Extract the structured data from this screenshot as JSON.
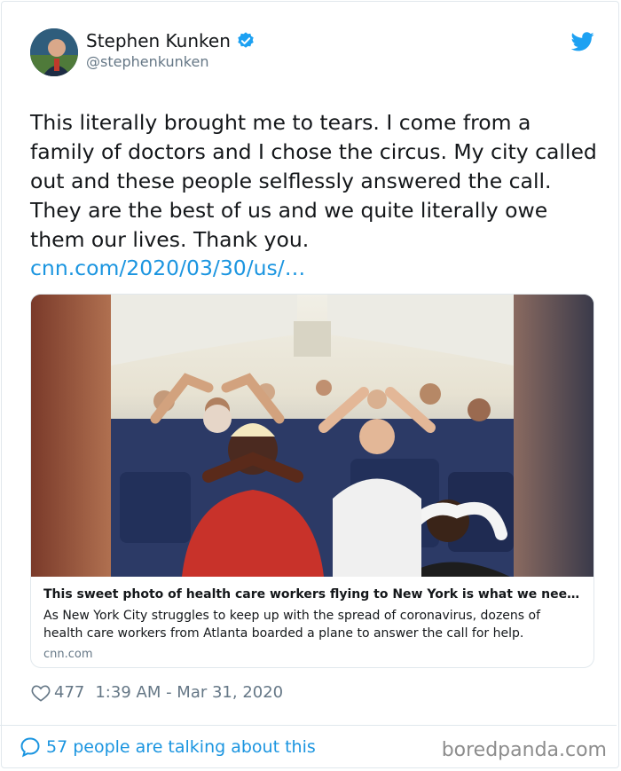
{
  "author": {
    "name": "Stephen Kunken",
    "handle": "@stephenkunken",
    "verified_icon": "verified-badge-icon",
    "avatar_icon": "avatar"
  },
  "platform_icon": "twitter-bird-icon",
  "tweet": {
    "text": "This literally brought me to tears. I come from a family of doctors and I chose the circus. My city called out and these people selflessly answered the call. They are the best of us and we quite literally owe them our lives.  Thank you.",
    "link": "cnn.com/2020/03/30/us/…"
  },
  "link_card": {
    "title": "This sweet photo of health care workers flying to New York is what we nee…",
    "description": "As New York City struggles to keep up with the spread of coronavirus, dozens of health care workers from Atlanta boarded a plane to answer the call for help.",
    "domain": "cnn.com"
  },
  "meta": {
    "likes": "477",
    "timestamp": "1:39 AM - Mar 31, 2020"
  },
  "footer": {
    "talking": "57 people are talking about this"
  },
  "watermark": "boredpanda.com",
  "colors": {
    "link": "#1b95e0",
    "secondary_text": "#657786",
    "border": "#e1e8ed"
  }
}
